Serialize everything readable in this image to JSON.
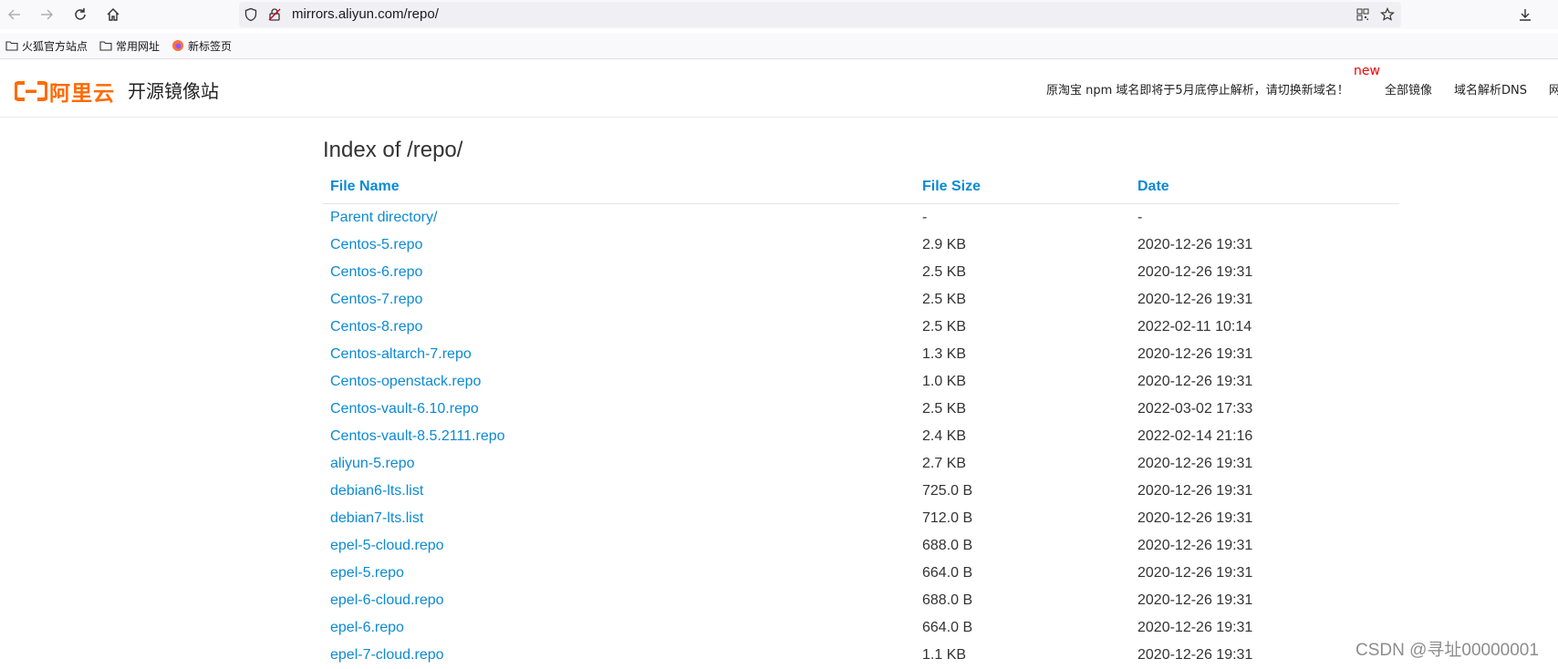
{
  "browser": {
    "url": "mirrors.aliyun.com/repo/",
    "bookmarks": [
      {
        "label": "火狐官方站点",
        "icon": "folder-icon"
      },
      {
        "label": "常用网址",
        "icon": "folder-icon"
      },
      {
        "label": "新标签页",
        "icon": "firefox-icon"
      }
    ]
  },
  "header": {
    "logo_text": "阿里云",
    "site_title": "开源镜像站",
    "notice": "原淘宝 npm 域名即将于5月底停止解析，请切换新域名！",
    "new_tag": "new",
    "nav": [
      "全部镜像",
      "域名解析DNS",
      "网"
    ]
  },
  "page": {
    "title": "Index of /repo/",
    "columns": [
      "File Name",
      "File Size",
      "Date"
    ],
    "rows": [
      {
        "name": "Parent directory/",
        "size": "-",
        "date": "-"
      },
      {
        "name": "Centos-5.repo",
        "size": "2.9 KB",
        "date": "2020-12-26 19:31"
      },
      {
        "name": "Centos-6.repo",
        "size": "2.5 KB",
        "date": "2020-12-26 19:31"
      },
      {
        "name": "Centos-7.repo",
        "size": "2.5 KB",
        "date": "2020-12-26 19:31"
      },
      {
        "name": "Centos-8.repo",
        "size": "2.5 KB",
        "date": "2022-02-11 10:14"
      },
      {
        "name": "Centos-altarch-7.repo",
        "size": "1.3 KB",
        "date": "2020-12-26 19:31"
      },
      {
        "name": "Centos-openstack.repo",
        "size": "1.0 KB",
        "date": "2020-12-26 19:31"
      },
      {
        "name": "Centos-vault-6.10.repo",
        "size": "2.5 KB",
        "date": "2022-03-02 17:33"
      },
      {
        "name": "Centos-vault-8.5.2111.repo",
        "size": "2.4 KB",
        "date": "2022-02-14 21:16"
      },
      {
        "name": "aliyun-5.repo",
        "size": "2.7 KB",
        "date": "2020-12-26 19:31"
      },
      {
        "name": "debian6-lts.list",
        "size": "725.0 B",
        "date": "2020-12-26 19:31"
      },
      {
        "name": "debian7-lts.list",
        "size": "712.0 B",
        "date": "2020-12-26 19:31"
      },
      {
        "name": "epel-5-cloud.repo",
        "size": "688.0 B",
        "date": "2020-12-26 19:31"
      },
      {
        "name": "epel-5.repo",
        "size": "664.0 B",
        "date": "2020-12-26 19:31"
      },
      {
        "name": "epel-6-cloud.repo",
        "size": "688.0 B",
        "date": "2020-12-26 19:31"
      },
      {
        "name": "epel-6.repo",
        "size": "664.0 B",
        "date": "2020-12-26 19:31"
      },
      {
        "name": "epel-7-cloud.repo",
        "size": "1.1 KB",
        "date": "2020-12-26 19:31"
      }
    ]
  },
  "watermark": "CSDN @寻址00000001",
  "colors": {
    "link": "#0c8ad3",
    "brand": "#ff6a00",
    "new_tag": "#ee0000"
  }
}
